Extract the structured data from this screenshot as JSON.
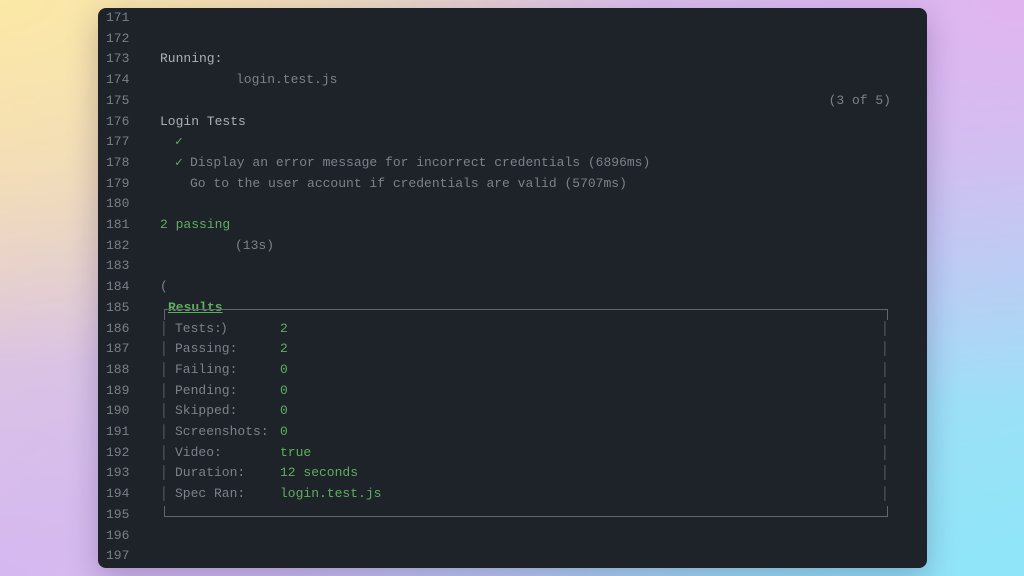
{
  "line_numbers": [
    "171",
    "172",
    "173",
    "174",
    "175",
    "176",
    "177",
    "178",
    "179",
    "180",
    "181",
    "182",
    "183",
    "184",
    "185",
    "186",
    "187",
    "188",
    "189",
    "190",
    "191",
    "192",
    "193",
    "194",
    "195",
    "196",
    "197"
  ],
  "running": {
    "label": "Running:",
    "file": "login.test.js",
    "progress": "(3 of 5)"
  },
  "suite": {
    "title": "Login Tests",
    "tests": [
      {
        "check": "✓",
        "text": "Display an error message for incorrect credentials (6896ms)"
      },
      {
        "check": "✓",
        "text": "Go to the user account if credentials are valid (5707ms)"
      }
    ]
  },
  "summary": {
    "passing": "2 passing",
    "duration": "(13s)"
  },
  "results": {
    "open": "(",
    "label": "Results",
    "close": ")"
  },
  "table": {
    "rows": [
      {
        "label": "Tests:",
        "value": "2"
      },
      {
        "label": "Passing:",
        "value": "2"
      },
      {
        "label": "Failing:",
        "value": "0"
      },
      {
        "label": "Pending:",
        "value": "0"
      },
      {
        "label": "Skipped:",
        "value": "0"
      },
      {
        "label": "Screenshots:",
        "value": "0"
      },
      {
        "label": "Video:",
        "value": "true"
      },
      {
        "label": "Duration:",
        "value": "12 seconds"
      },
      {
        "label": "Spec Ran:",
        "value": "login.test.js"
      }
    ]
  },
  "colors": {
    "background": "#1e2229",
    "green": "#5cb05c",
    "gray": "#7b828c",
    "border": "#5f6670"
  }
}
